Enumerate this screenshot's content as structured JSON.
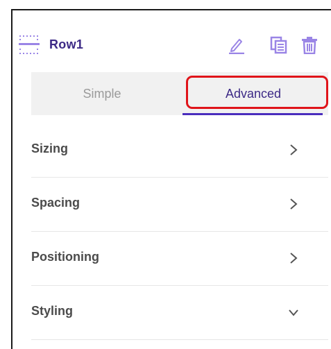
{
  "header": {
    "title": "Row1",
    "icons": {
      "row": "row-layout-icon",
      "edit": "pencil-icon",
      "copy": "copy-icon",
      "delete": "trash-icon"
    }
  },
  "tabs": [
    {
      "label": "Simple",
      "active": false
    },
    {
      "label": "Advanced",
      "active": true,
      "highlighted": true
    }
  ],
  "sections": [
    {
      "label": "Sizing",
      "chevron": "chevron-right-icon"
    },
    {
      "label": "Spacing",
      "chevron": "chevron-right-icon"
    },
    {
      "label": "Positioning",
      "chevron": "chevron-right-icon"
    },
    {
      "label": "Styling",
      "chevron": "chevron-down-icon"
    }
  ],
  "colors": {
    "accent": "#4a2dbd",
    "title": "#3d2a86",
    "icon": "#9a85e6",
    "highlight": "#e0141a",
    "tab_background": "#f1f1f1"
  }
}
